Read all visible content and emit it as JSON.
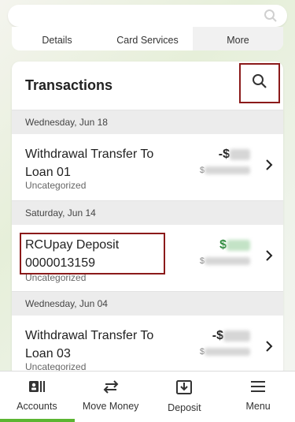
{
  "subtabs": [
    "Details",
    "Card Services",
    "More"
  ],
  "transactions_title": "Transactions",
  "groups": [
    {
      "date": "Wednesday, Jun 18",
      "items": [
        {
          "description": "Withdrawal Transfer To Loan 01",
          "category": "Uncategorized",
          "amount_prefix": "-$",
          "type": "debit",
          "balance_prefix": "$"
        }
      ]
    },
    {
      "date": "Saturday, Jun 14",
      "items": [
        {
          "description": "RCUpay Deposit 0000013159",
          "category": "Uncategorized",
          "amount_prefix": "$",
          "type": "credit",
          "balance_prefix": "$"
        }
      ]
    },
    {
      "date": "Wednesday, Jun 04",
      "items": [
        {
          "description": "Withdrawal Transfer To Loan 03",
          "category": "Uncategorized",
          "amount_prefix": "-$",
          "type": "debit",
          "balance_prefix": "$"
        }
      ]
    }
  ],
  "nav": [
    {
      "label": "Accounts",
      "icon": "accounts-icon"
    },
    {
      "label": "Move Money",
      "icon": "transfer-arrows-icon"
    },
    {
      "label": "Deposit",
      "icon": "deposit-icon"
    },
    {
      "label": "Menu",
      "icon": "hamburger-menu-icon"
    }
  ],
  "colors": {
    "accent": "#5bb531",
    "credit": "#2e8b3d",
    "highlight": "#8b1a1a"
  }
}
